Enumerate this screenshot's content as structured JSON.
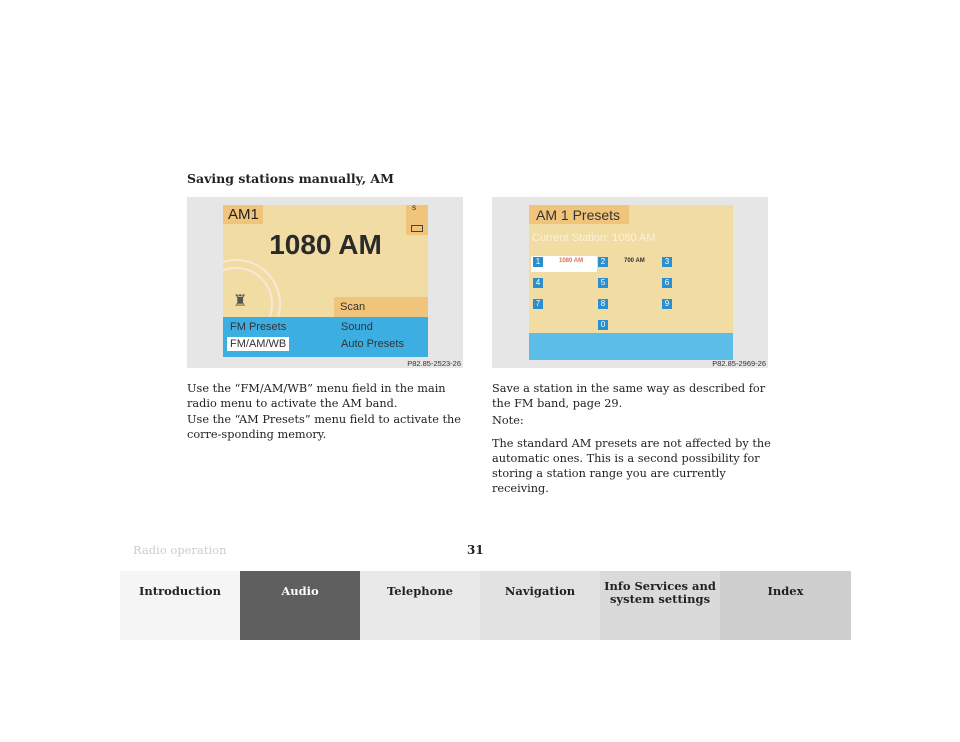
{
  "heading": "Saving stations manually, AM",
  "figure1": {
    "band": "AM1",
    "frequency": "1080 AM",
    "scan": "Scan",
    "menu": [
      "FM Presets",
      "Sound",
      "FM/AM/WB",
      "Auto Presets"
    ],
    "indicator": "S",
    "code": "P82.85-2523-26"
  },
  "figure2": {
    "title": "AM 1 Presets",
    "current": "Current Station:  1080 AM",
    "presets": [
      {
        "n": "1",
        "v": "1080 AM"
      },
      {
        "n": "2",
        "v": "700 AM"
      },
      {
        "n": "3",
        "v": ""
      },
      {
        "n": "4",
        "v": ""
      },
      {
        "n": "5",
        "v": ""
      },
      {
        "n": "6",
        "v": ""
      },
      {
        "n": "7",
        "v": ""
      },
      {
        "n": "8",
        "v": ""
      },
      {
        "n": "9",
        "v": ""
      },
      {
        "n": "0",
        "v": ""
      }
    ],
    "code": "P82.85-2969-26"
  },
  "left_text": [
    "Use the “FM/AM/WB” menu field in the main radio menu to activate the AM band.",
    "Use the “AM Presets” menu field to activate the corre-sponding memory."
  ],
  "right_text": [
    "Save a station in the same way as described for the FM band, page 29.",
    "Note:",
    "The standard AM presets are not affected by the automatic ones. This is a second possibility for storing a station range you are currently receiving."
  ],
  "footer": {
    "section": "Radio operation",
    "page": "31"
  },
  "tabs": [
    {
      "label": "Introduction",
      "color": "#f5f5f5"
    },
    {
      "label": "Audio",
      "color": "#5f5f5f"
    },
    {
      "label": "Telephone",
      "color": "#e9e9e9"
    },
    {
      "label": "Navigation",
      "color": "#e2e2e2"
    },
    {
      "label": "Info Services and system settings",
      "color": "#dadada"
    },
    {
      "label": "Index",
      "color": "#cfcfcf"
    }
  ]
}
